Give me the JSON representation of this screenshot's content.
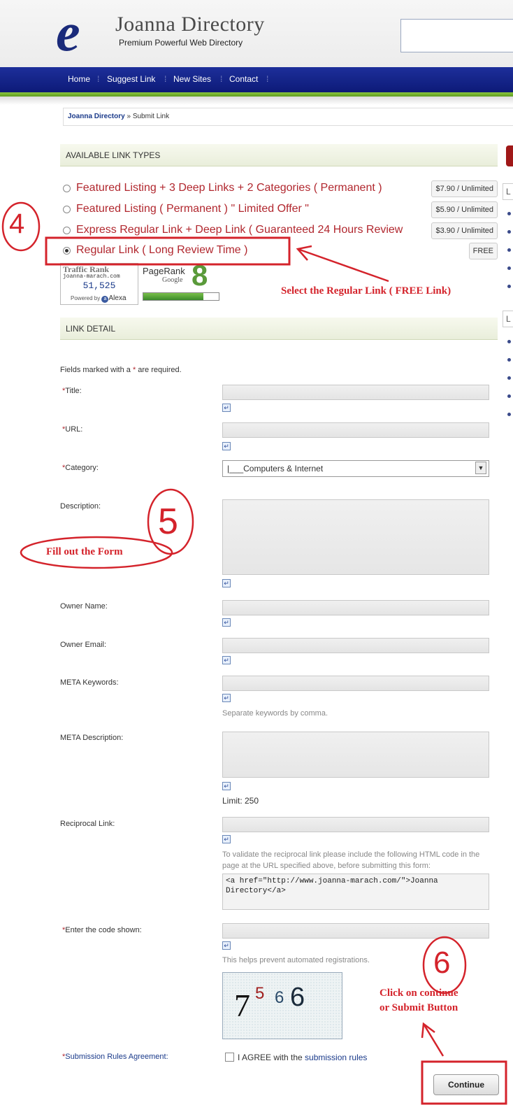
{
  "header": {
    "logo_letter": "e",
    "logo_title": "Joanna Directory",
    "logo_subtitle": "Premium Powerful Web Directory"
  },
  "nav": {
    "items": [
      "Home",
      "Suggest Link",
      "New Sites",
      "Contact"
    ]
  },
  "breadcrumb": {
    "home": "Joanna Directory",
    "separator": " » ",
    "current": "Submit Link"
  },
  "link_types": {
    "heading": "AVAILABLE LINK TYPES",
    "options": [
      {
        "label": "Featured Listing + 3 Deep Links + 2 Categories ( Permanent )",
        "price": "$7.90 / Unlimited",
        "checked": false
      },
      {
        "label": "Featured Listing ( Permanent ) \" Limited Offer \"",
        "price": "$5.90 / Unlimited",
        "checked": false
      },
      {
        "label": "Express Regular Link + Deep Link ( Guaranteed 24 Hours Review",
        "price": "$3.90 / Unlimited",
        "checked": false
      },
      {
        "label": "Regular Link ( Long Review Time )",
        "price": "FREE",
        "checked": true
      }
    ]
  },
  "badges": {
    "traffic_title": "Traffic Rank",
    "traffic_domain": "joanna-marach.com",
    "traffic_value": "51,525",
    "traffic_powered": "Powered by",
    "traffic_brand": "Alexa",
    "pagerank_title": "PageRank",
    "pagerank_google": "Google",
    "pagerank_value": "8",
    "pagerank_fill": 0.8
  },
  "link_detail": {
    "heading": "LINK DETAIL",
    "required_note_prefix": "Fields marked with a ",
    "required_star": "*",
    "required_note_suffix": " are required.",
    "fields": {
      "title": "Title:",
      "url": "URL:",
      "category": "Category:",
      "category_value": "|___Computers & Internet",
      "description": "Description:",
      "owner_name": "Owner Name:",
      "owner_email": "Owner Email:",
      "meta_keywords": "META Keywords:",
      "meta_keywords_hint": "Separate keywords by comma.",
      "meta_description": "META Description:",
      "meta_limit": "Limit: 250",
      "reciprocal": "Reciprocal Link:",
      "reciprocal_hint": "To validate the reciprocal link please include the following HTML code in the page at the URL specified above, before submitting this form:",
      "reciprocal_code": "<a href=\"http://www.joanna-marach.com/\">Joanna Directory</a>",
      "code": "Enter the code shown:",
      "code_hint": "This helps prevent automated registrations.",
      "captcha_digits": [
        "7",
        "5",
        "6",
        "6"
      ],
      "rules": "Submission Rules Agreement:",
      "agree_prefix": "I AGREE with the ",
      "agree_link": "submission rules",
      "continue": "Continue"
    }
  },
  "annotations": {
    "step4": "4",
    "step5": "5",
    "step6": "6",
    "select_text": "Select the Regular Link ( FREE  Link)",
    "fill_text": "Fill out the Form",
    "click_text_1": "Click on continue",
    "click_text_2": "or Submit Button",
    "color": "#d4232b"
  },
  "colors": {
    "nav_blue": "#0d1a78",
    "accent_green": "#8cc63f",
    "link_red": "#b1272e"
  }
}
